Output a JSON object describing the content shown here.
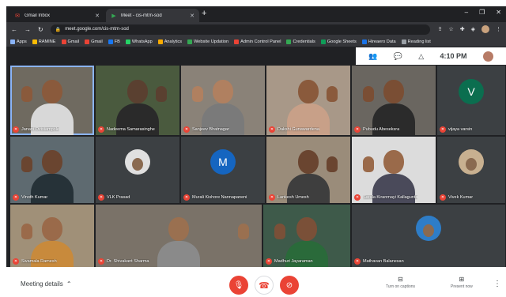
{
  "browser": {
    "tabs": [
      {
        "title": "Gmail Inbox",
        "icon": "gmail-icon"
      },
      {
        "title": "Meet - cis-mtrn-sod",
        "icon": "meet-icon"
      }
    ],
    "new_tab": "+",
    "controls": {
      "minimize": "–",
      "maximize": "❐",
      "close": "✕"
    },
    "url": "meet.google.com/cis-mtrn-sod",
    "bookmarks": [
      {
        "label": "Apps",
        "color": "#8ab4f8"
      },
      {
        "label": "RAMINE",
        "color": "#fbbc04"
      },
      {
        "label": "Gmail",
        "color": "#ea4335"
      },
      {
        "label": "Gmail",
        "color": "#ea4335"
      },
      {
        "label": "FB",
        "color": "#1877f2"
      },
      {
        "label": "WhatsApp",
        "color": "#25d366"
      },
      {
        "label": "Analytics",
        "color": "#f9ab00"
      },
      {
        "label": "Website Updation",
        "color": "#34a853"
      },
      {
        "label": "Admin Control Panel",
        "color": "#ea4335"
      },
      {
        "label": "Credentials",
        "color": "#34a853"
      },
      {
        "label": "Google Sheets",
        "color": "#0f9d58"
      },
      {
        "label": "Hireaero Data",
        "color": "#1a73e8"
      },
      {
        "label": "Reading list",
        "color": "#9aa0a6"
      }
    ]
  },
  "meet_header": {
    "time": "4:10 PM"
  },
  "participants": [
    {
      "name": "Janani Ovisiampole",
      "kind": "camera",
      "skin": "#8a5a3c",
      "shirt": "#d8d8d8",
      "bg": "#6f6a60"
    },
    {
      "name": "Nadeema Samarasinghe",
      "kind": "camera",
      "skin": "#5a4030",
      "shirt": "#2a2a2a",
      "bg": "#4a5a3e"
    },
    {
      "name": "Sanjeev Bhatnagar",
      "kind": "camera",
      "skin": "#b08060",
      "shirt": "#7a7a7a",
      "bg": "#8a8278"
    },
    {
      "name": "Dakshi Gunawardena",
      "kind": "camera",
      "skin": "#8a5a3c",
      "shirt": "#c8a088",
      "bg": "#a89888"
    },
    {
      "name": "Pubudu Abeseksra",
      "kind": "camera",
      "skin": "#7a4e34",
      "shirt": "#2b2b2b",
      "bg": "#6a6660"
    },
    {
      "name": "vijaya varsin",
      "kind": "avatar",
      "initial": "V",
      "avatar_color": "#0b6e4f"
    },
    {
      "name": "Vinoth Kumar",
      "kind": "camera",
      "skin": "#6a4530",
      "shirt": "#263238",
      "bg": "#5e6a70"
    },
    {
      "name": "VLK Prasad",
      "kind": "avatar",
      "initial": "",
      "avatar_color": "#e0e0e0"
    },
    {
      "name": "Murali Kishore Nannapaneni",
      "kind": "avatar",
      "initial": "M",
      "avatar_color": "#1565c0"
    },
    {
      "name": "Lankesh Umesh",
      "kind": "camera",
      "skin": "#6a4530",
      "shirt": "#3e3e3e",
      "bg": "#9a8c7a"
    },
    {
      "name": "Sarala Kiranmayi Kallagunta",
      "kind": "camera",
      "skin": "#9a6a4a",
      "shirt": "#4a4a5a",
      "bg": "#dcdcdc"
    },
    {
      "name": "Vivek Kumar",
      "kind": "avatar",
      "initial": "",
      "avatar_color": "#c8b090"
    },
    {
      "name": "Sivamala Ramesh",
      "kind": "camera",
      "skin": "#9a6a4a",
      "shirt": "#c88a3c",
      "bg": "#a09078"
    },
    {
      "name": "Dr. Shivakant Sharma",
      "kind": "camera",
      "skin": "#9a7050",
      "shirt": "#8a8a8a",
      "bg": "#7a7268"
    },
    {
      "name": "Madhuri Jayaraman",
      "kind": "camera",
      "skin": "#7a5038",
      "shirt": "#2a6a3a",
      "bg": "#3e5a4a"
    },
    {
      "name": "Mathavan Balanesan",
      "kind": "avatar",
      "initial": "",
      "avatar_color": "#2e7dc7"
    }
  ],
  "bottom_bar": {
    "meeting_details": "Meeting details",
    "captions_label": "Turn on captions",
    "present_label": "Present now"
  }
}
